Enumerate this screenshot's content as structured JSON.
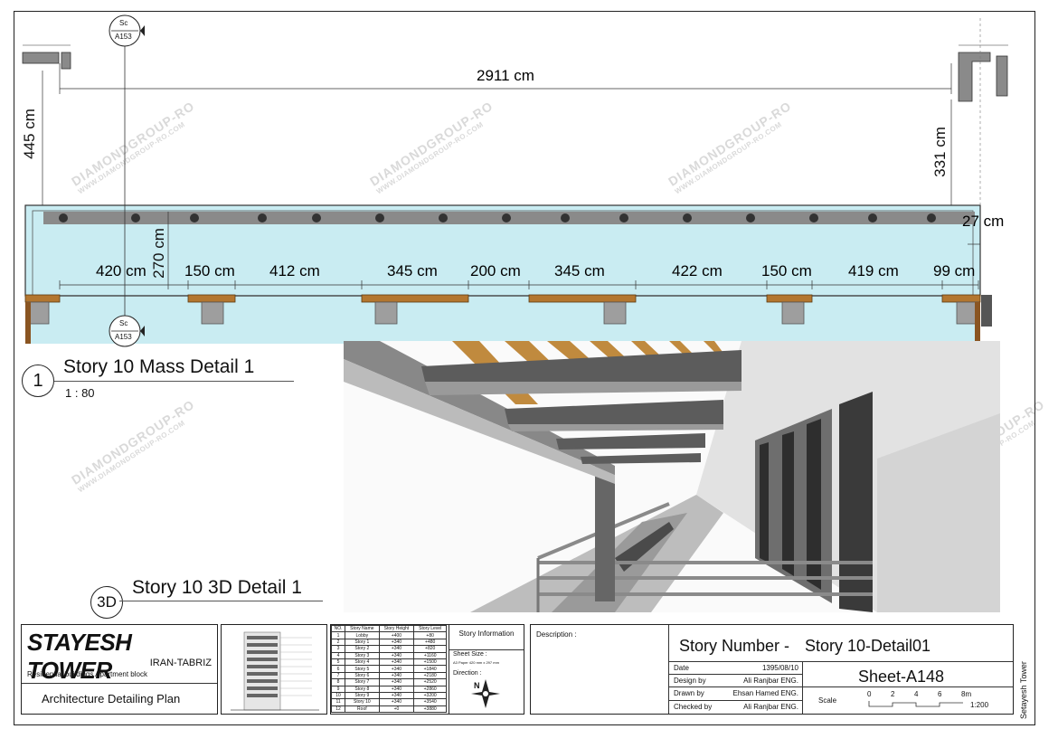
{
  "plan": {
    "overall_dimension": "2911 cm",
    "left_height": "445 cm",
    "right_height": "331 cm",
    "canopy_height": "270 cm",
    "offset": "27 cm",
    "segments": [
      "420 cm",
      "150 cm",
      "412 cm",
      "345 cm",
      "200 cm",
      "345 cm",
      "422 cm",
      "150 cm",
      "419 cm",
      "99 cm"
    ],
    "section_tag": {
      "top": "Sc",
      "bottom": "A153"
    }
  },
  "views": {
    "mass": {
      "number": "1",
      "title": "Story 10 Mass Detail 1",
      "scale": "1 : 80"
    },
    "detail3d": {
      "number": "3D",
      "title": "Story 10 3D Detail 1"
    }
  },
  "titleblock": {
    "project": "STAYESH TOWER",
    "location": "IRAN-TABRIZ",
    "type": "Residential buildings Apartment block",
    "plan_name": "Architecture Detailing Plan",
    "story_table": {
      "headers": [
        "NO.",
        "Story Name",
        "Story Height",
        "Story Level"
      ],
      "rows": [
        [
          "1",
          "Lobby",
          "+400",
          "+80"
        ],
        [
          "2",
          "Story 1",
          "+340",
          "+480"
        ],
        [
          "3",
          "Story 2",
          "+340",
          "+820"
        ],
        [
          "4",
          "Story 3",
          "+340",
          "+1160"
        ],
        [
          "5",
          "Story 4",
          "+340",
          "+1500"
        ],
        [
          "6",
          "Story 5",
          "+340",
          "+1840"
        ],
        [
          "7",
          "Story 6",
          "+340",
          "+2180"
        ],
        [
          "8",
          "Story 7",
          "+340",
          "+2520"
        ],
        [
          "9",
          "Story 8",
          "+340",
          "+2860"
        ],
        [
          "10",
          "Story 9",
          "+340",
          "+3200"
        ],
        [
          "11",
          "Story 10",
          "+340",
          "+3540"
        ],
        [
          "12",
          "Roof",
          "+0",
          "+3880"
        ]
      ]
    },
    "story_info": {
      "heading": "Story Information",
      "sheet_size_label": "Sheet Size :",
      "sheet_size_value": "A3 Paper 420 mm x 297 mm",
      "direction_label": "Direction :",
      "north": "N"
    },
    "description_label": "Description :",
    "story_number_label": "Story Number -",
    "story_number_value": "Story 10-Detail01",
    "date_label": "Date",
    "date_value": "1395/08/10",
    "design_label": "Design by",
    "design_value": "Ali Ranjbar ENG.",
    "drawn_label": "Drawn by",
    "drawn_value": "Ehsan Hamed ENG.",
    "checked_label": "Checked by",
    "checked_value": "Ali Ranjbar ENG.",
    "sheet": "Sheet-A148",
    "scale_label": "Scale",
    "scale_ticks": [
      "0",
      "2",
      "4",
      "6",
      "8m"
    ],
    "scale_ratio": "1:200",
    "side_text": "Setayesh Tower"
  },
  "watermark": {
    "main": "DIAMONDGROUP-RO",
    "sub": "WWW.DIAMONDGROUP-RO.COM"
  }
}
